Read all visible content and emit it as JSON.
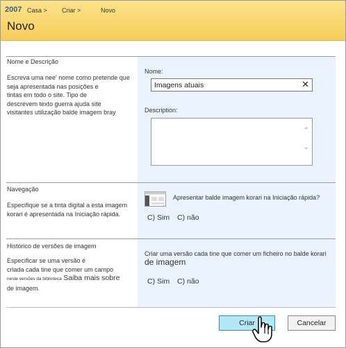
{
  "breadcrumb": {
    "year": "2007",
    "casa": "Casa >",
    "criar": "Criar >",
    "novo": "Novo"
  },
  "page_title": "Novo",
  "section_name": {
    "title": "Nome e Descrição",
    "desc_lines": [
      "Escreva uma nee' nome como pretende que",
      "seja apresentada nas posições e",
      "tintas em todo o site. Tipo de",
      "descrevem texto guerra ajuda site",
      "visitantes utilização balde imagem bray"
    ],
    "name_label": "Nome:",
    "name_value": "Imagens atuais",
    "description_label": "Description:"
  },
  "section_nav": {
    "title": "Navegação",
    "desc_lines": [
      "Especifique se a tinta digital a esta imagem",
      "korari é apresentada na Iniciação rápida."
    ],
    "option_text": "Apresentar balde imagem korari na Iniciação rápida?",
    "yes": "C) Sim",
    "no": "C) não"
  },
  "section_versions": {
    "title": "Histórico de versões de imagem",
    "desc_line1": "Especificar se uma versão é",
    "desc_line2": "criada cada tine que comer um campo",
    "desc_small": "neste versões da biblioteca",
    "desc_link": "Saiba mais sobre",
    "desc_line4": "de imagem.",
    "option_line1": "Criar uma versão cada tine que comer um ficheiro no balde korari",
    "option_line2": "de imagem",
    "yes": "C) Sim",
    "no": "C) não"
  },
  "buttons": {
    "create": "Criar",
    "cancel": "Cancelar"
  },
  "colors": {
    "header_top": "#fce38a",
    "header_bottom": "#f7cd5a",
    "panel": "#eaf3fd",
    "create_button": "#b5e8f7",
    "link_blue": "#3a5a96"
  }
}
